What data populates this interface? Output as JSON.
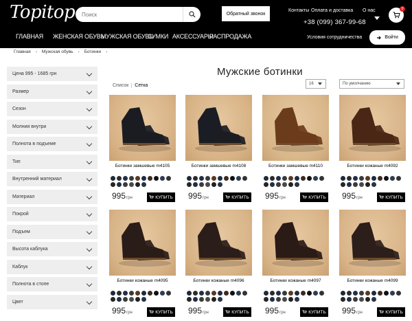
{
  "header": {
    "logo": "Topitop",
    "search_placeholder": "Поиск",
    "callback": "Обратный звонок",
    "links": [
      "Контакты",
      "Оплата и доставка",
      "О нас"
    ],
    "phone": "+38 (099) 367-99-68",
    "cart_count": "0",
    "partner": "Условия сотрудничества",
    "login": "Войти"
  },
  "nav": [
    "ГЛАВНАЯ",
    "ЖЕНСКАЯ ОБУВЬ",
    "МУЖСКАЯ ОБУВЬ",
    "СУМКИ",
    "АКСЕССУАРЫ",
    "РАСПРОДАЖА"
  ],
  "breadcrumb": [
    "Главная",
    "Мужская обувь",
    "Ботинки"
  ],
  "filters": [
    "Цена 995 - 1685 грн",
    "Размер",
    "Сезон",
    "Молния внутри",
    "Полнота в подъеме",
    "Тип",
    "Внутренний материал",
    "Материал",
    "Покрой",
    "Подъем",
    "Высота каблука",
    "Каблук",
    "Полнота в стопе",
    "Цвет"
  ],
  "page_title": "Мужские ботинки",
  "view": {
    "list": "Список",
    "grid": "Сетка"
  },
  "per_page": "16",
  "sort": "По умолчанию",
  "buy_label": "КУПИТЬ",
  "currency": "грн",
  "products": [
    {
      "name": "Ботинки замшевые m4105",
      "price": "995",
      "shoe": "#1a1c22",
      "bg": "#d8b286"
    },
    {
      "name": "Ботинки замшевые m4108",
      "price": "995",
      "shoe": "#1b1d24",
      "bg": "#d7b285"
    },
    {
      "name": "Ботинки замшевые m4110",
      "price": "995",
      "shoe": "#6b3c1c",
      "bg": "#d8b689"
    },
    {
      "name": "Ботинки кожаные m4092",
      "price": "995",
      "shoe": "#4a2616",
      "bg": "#d9b48a"
    },
    {
      "name": "Ботинки кожаные m4095",
      "price": "995",
      "shoe": "#2a1c18",
      "bg": "#d7b387"
    },
    {
      "name": "Ботинки кожаные m4096",
      "price": "995",
      "shoe": "#2b1d19",
      "bg": "#d8b488"
    },
    {
      "name": "Ботинки кожаные m4097",
      "price": "995",
      "shoe": "#2a1b17",
      "bg": "#d8b387"
    },
    {
      "name": "Ботинки кожаные m4099",
      "price": "995",
      "shoe": "#2c1e1a",
      "bg": "#d9b489"
    }
  ],
  "swatch_colors": [
    "#1e2a3a",
    "#2b2b2b",
    "#20304a",
    "#3a3a3a",
    "#5a3a22",
    "#1c2c44",
    "#3d2a1e",
    "#111111",
    "#2c3e50",
    "#333333",
    "#262626",
    "#1f2f46",
    "#3b3b3b",
    "#4a4a4a",
    "#222222",
    "#2a3344"
  ]
}
